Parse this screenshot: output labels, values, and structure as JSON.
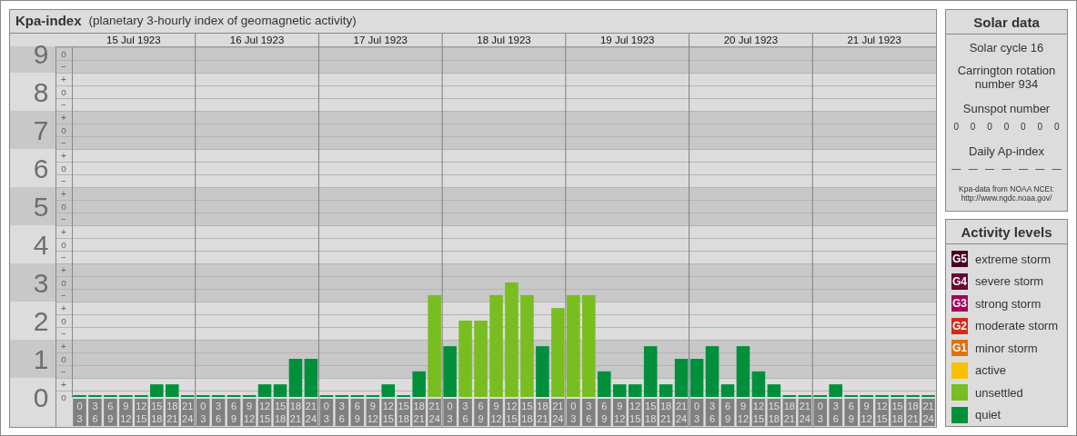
{
  "chart_panel": {
    "title": "Kpa-index",
    "subtitle": "(planetary 3-hourly index of geomagnetic activity)",
    "days": [
      "15 Jul 1923",
      "16 Jul 1923",
      "17 Jul 1923",
      "18 Jul 1923",
      "19 Jul 1923",
      "20 Jul 1923",
      "21 Jul 1923"
    ],
    "scale_signs": [
      [
        "o",
        "−"
      ],
      [
        "+",
        "o",
        "−"
      ],
      [
        "+",
        "o",
        "−"
      ],
      [
        "+",
        "o",
        "−"
      ],
      [
        "+",
        "o",
        "−"
      ],
      [
        "+",
        "o",
        "−"
      ],
      [
        "+",
        "o",
        "−"
      ],
      [
        "+",
        "o",
        "−"
      ],
      [
        "+",
        "o",
        "−"
      ],
      [
        "+",
        "o"
      ]
    ],
    "chart_data": {
      "type": "bar",
      "grid": true,
      "ylim": [
        0,
        9
      ],
      "yticks": [
        0,
        1,
        2,
        3,
        4,
        5,
        6,
        7,
        8,
        9
      ],
      "categories": [
        "0 3",
        "3 6",
        "6 9",
        "9 12",
        "12 15",
        "15 18",
        "18 21",
        "21 24",
        "0 3",
        "3 6",
        "6 9",
        "9 12",
        "12 15",
        "15 18",
        "18 21",
        "21 24",
        "0 3",
        "3 6",
        "6 9",
        "9 12",
        "12 15",
        "15 18",
        "18 21",
        "21 24",
        "0 3",
        "3 6",
        "6 9",
        "9 12",
        "12 15",
        "15 18",
        "18 21",
        "21 24",
        "0 3",
        "3 6",
        "6 9",
        "9 12",
        "12 15",
        "15 18",
        "18 21",
        "21 24",
        "0 3",
        "3 6",
        "6 9",
        "9 12",
        "12 15",
        "15 18",
        "18 21",
        "21 24",
        "0 3",
        "3 6",
        "6 9",
        "9 12",
        "12 15",
        "15 18",
        "18 21",
        "21 24"
      ],
      "series": [
        {
          "color": "#00903c",
          "values": [
            0,
            0,
            0,
            0,
            0,
            0.33,
            0.33,
            0,
            0,
            0,
            0,
            0,
            0.33,
            0.33,
            1,
            1,
            0,
            0,
            0,
            0,
            0.33,
            0,
            0.67,
            null,
            1.33,
            null,
            null,
            null,
            null,
            null,
            1.33,
            null,
            null,
            null,
            0.67,
            0.33,
            0.33,
            1.33,
            0.33,
            1,
            1,
            1.33,
            0.33,
            1.33,
            0.67,
            0.33,
            0,
            0,
            0,
            0.33,
            0,
            0,
            0,
            0,
            0,
            0
          ]
        },
        {
          "color": "#78be20",
          "values": [
            null,
            null,
            null,
            null,
            null,
            null,
            null,
            null,
            null,
            null,
            null,
            null,
            null,
            null,
            null,
            null,
            null,
            null,
            null,
            null,
            null,
            null,
            null,
            2.67,
            null,
            2,
            2,
            2.67,
            3,
            2.67,
            null,
            2.33,
            2.67,
            2.67,
            null,
            null,
            null,
            null,
            null,
            null,
            null,
            null,
            null,
            null,
            null,
            null,
            null,
            null,
            null,
            null,
            null,
            null,
            null,
            null,
            null,
            null
          ]
        }
      ]
    }
  },
  "solar_data": {
    "title": "Solar data",
    "cycle": "Solar cycle 16",
    "rotation": "Carrington rotation number 934",
    "sunspot_label": "Sunspot number",
    "sunspots": [
      "0",
      "0",
      "0",
      "0",
      "0",
      "0",
      "0"
    ],
    "ap_label": "Daily Ap-index",
    "ap_values": [
      "—",
      "—",
      "—",
      "—",
      "—",
      "—",
      "—"
    ],
    "source": "Kpa-data from NOAA NCEI:",
    "source_url": "http://www.ngdc.noaa.gov/"
  },
  "activity_levels": {
    "title": "Activity levels",
    "items": [
      {
        "code": "G5",
        "label": "extreme storm",
        "color": "#4a0022"
      },
      {
        "code": "G4",
        "label": "severe storm",
        "color": "#6a0038"
      },
      {
        "code": "G3",
        "label": "strong storm",
        "color": "#a8005a"
      },
      {
        "code": "G2",
        "label": "moderate storm",
        "color": "#d42a1a"
      },
      {
        "code": "G1",
        "label": "minor storm",
        "color": "#e07010"
      },
      {
        "label": "active",
        "color": "#f8c000"
      },
      {
        "label": "unsettled",
        "color": "#78be20"
      },
      {
        "label": "quiet",
        "color": "#00903c"
      }
    ]
  }
}
